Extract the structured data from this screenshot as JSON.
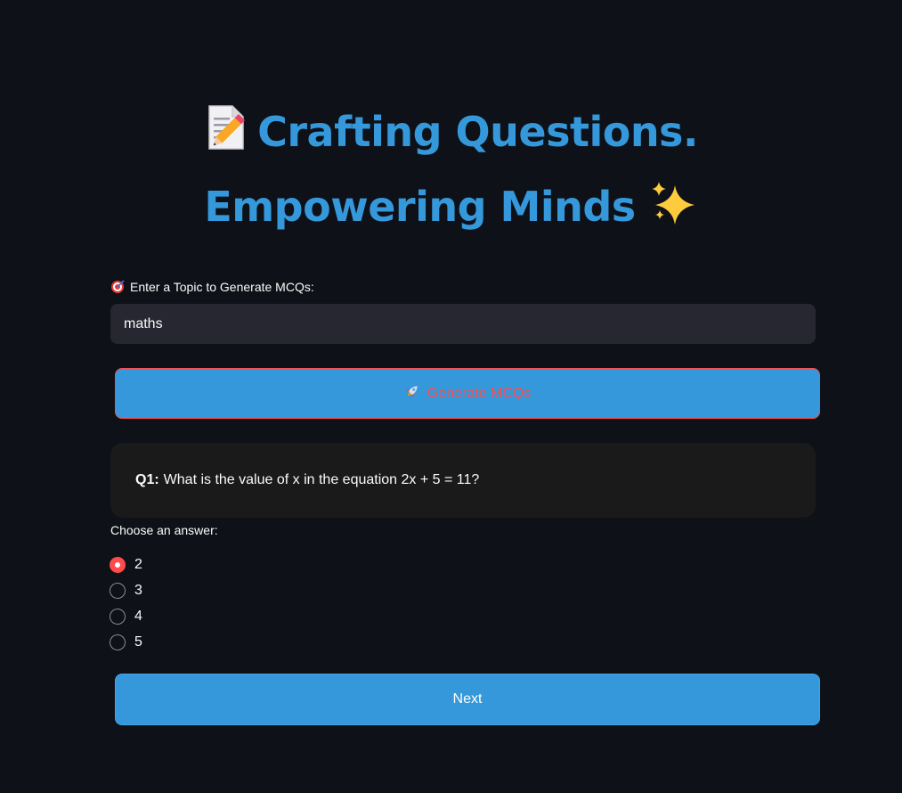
{
  "header": {
    "title_line_1": "Crafting Questions.",
    "title_line_2": "Empowering Minds",
    "leading_icon": "memo-icon",
    "trailing_icon": "sparkles-icon"
  },
  "topic": {
    "label": "Enter a Topic to Generate MCQs:",
    "label_icon": "target-icon",
    "value": "maths"
  },
  "generate_button": {
    "label": "Generate MCQs",
    "icon": "rocket-icon"
  },
  "question": {
    "number_label": "Q1:",
    "text": "What is the value of x in the equation 2x + 5 = 11?"
  },
  "answers": {
    "label": "Choose an answer:",
    "selected_index": 0,
    "options": [
      "2",
      "3",
      "4",
      "5"
    ]
  },
  "next_button": {
    "label": "Next"
  },
  "colors": {
    "background": "#0e1117",
    "accent_blue": "#3498db",
    "accent_red": "#ff4b4b",
    "input_bg": "#262730",
    "card_bg": "#1a1a1a"
  }
}
